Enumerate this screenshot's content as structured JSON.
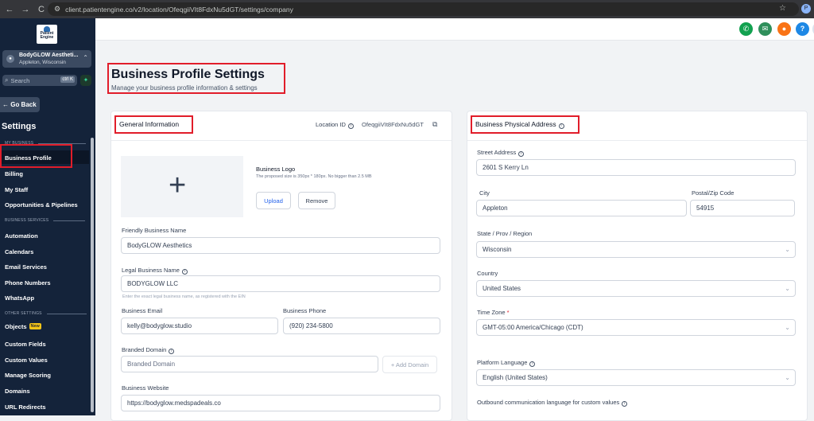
{
  "browser": {
    "url": "client.patientengine.co/v2/location/OfeqgiiVIt8FdxNu5dGT/settings/company",
    "back": "←",
    "forward": "→",
    "reload": "C",
    "star": "☆",
    "profile_initial": "P"
  },
  "sidebar": {
    "logo_text": "Patient Engine",
    "account": {
      "name": "BodyGLOW Aestheti...",
      "location": "Appleton, Wisconsin",
      "caret": "⌃"
    },
    "search": {
      "placeholder": "Search",
      "shortcut": "ctrl K",
      "icon": "⌕"
    },
    "spark": "✦",
    "go_back": "← Go Back",
    "settings_title": "Settings",
    "sections": [
      {
        "label": "MY BUSINESS"
      },
      {
        "label": "BUSINESS SERVICES"
      },
      {
        "label": "OTHER SETTINGS"
      }
    ],
    "items": [
      {
        "label": "Business Profile"
      },
      {
        "label": "Billing"
      },
      {
        "label": "My Staff"
      },
      {
        "label": "Opportunities & Pipelines"
      },
      {
        "label": "Automation"
      },
      {
        "label": "Calendars"
      },
      {
        "label": "Email Services"
      },
      {
        "label": "Phone Numbers"
      },
      {
        "label": "WhatsApp"
      },
      {
        "label": "Objects",
        "badge": "New"
      },
      {
        "label": "Custom Fields"
      },
      {
        "label": "Custom Values"
      },
      {
        "label": "Manage Scoring"
      },
      {
        "label": "Domains"
      },
      {
        "label": "URL Redirects"
      }
    ]
  },
  "topbar": {
    "icons": [
      {
        "name": "phone-icon",
        "glyph": "✆",
        "color": "#12a150"
      },
      {
        "name": "megaphone-icon",
        "glyph": "📢",
        "color": "#2f8f5b"
      },
      {
        "name": "bell-icon",
        "glyph": "🔔",
        "color": "#f97316"
      },
      {
        "name": "help-icon",
        "glyph": "?",
        "color": "#1e88e5"
      },
      {
        "name": "avatar-icon",
        "glyph": "",
        "color": "#dbe3ee"
      }
    ]
  },
  "page": {
    "title": "Business Profile Settings",
    "subtitle": "Manage your business profile information & settings"
  },
  "general": {
    "title": "General Information",
    "location_id_label": "Location ID",
    "location_id": "OfeqgiiVIt8FdxNu5dGT",
    "logo_label": "Business Logo",
    "logo_hint": "The proposed size is 350px * 180px. No bigger than 2.5 MB",
    "upload_button": "Upload",
    "remove_button": "Remove",
    "friendly_name_label": "Friendly Business Name",
    "friendly_name": "BodyGLOW Aesthetics",
    "legal_name_label": "Legal Business Name",
    "legal_name": "BODYGLOW LLC",
    "legal_name_hint": "Enter the exact legal business name, as registered with the EIN",
    "email_label": "Business Email",
    "email": "kelly@bodyglow.studio",
    "phone_label": "Business Phone",
    "phone": "(920) 234-5800",
    "branded_domain_label": "Branded Domain",
    "branded_domain_placeholder": "Branded Domain",
    "add_domain_button": "+ Add Domain",
    "website_label": "Business Website",
    "website": "https://bodyglow.medspadeals.co"
  },
  "address": {
    "title": "Business Physical Address",
    "street_label": "Street Address",
    "street": "2601 S Kerry Ln",
    "city_label": "City",
    "city": "Appleton",
    "zip_label": "Postal/Zip Code",
    "zip": "54915",
    "state_label": "State / Prov / Region",
    "state": "Wisconsin",
    "country_label": "Country",
    "country": "United States",
    "timezone_label": "Time Zone",
    "timezone_required": "*",
    "timezone": "GMT-05:00 America/Chicago (CDT)",
    "language_label": "Platform Language",
    "language": "English (United States)",
    "outbound_label": "Outbound communication language for custom values"
  }
}
